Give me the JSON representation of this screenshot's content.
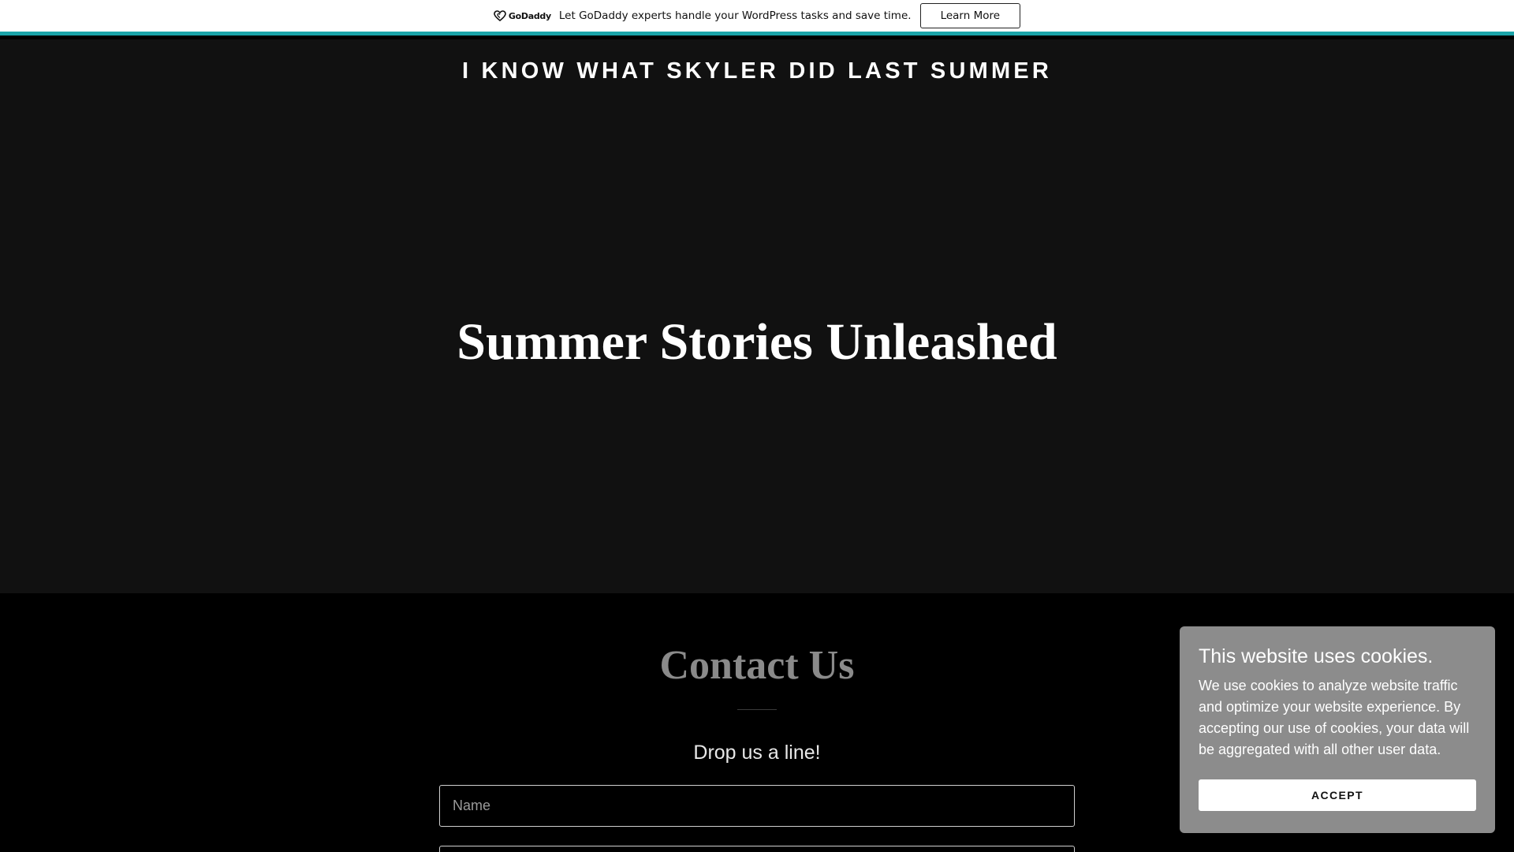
{
  "top_banner": {
    "logo_text": "GoDaddy",
    "message": "Let GoDaddy experts handle your WordPress tasks and save time.",
    "button_label": "Learn More",
    "accent_color": "#1aa3a8"
  },
  "header": {
    "site_title": "I KNOW WHAT SKYLER DID LAST SUMMER"
  },
  "hero": {
    "heading": "Summer Stories Unleashed",
    "background_color": "#111111"
  },
  "contact": {
    "title": "Contact Us",
    "subtitle": "Drop us a line!",
    "name_placeholder": "Name",
    "next_placeholder": ""
  },
  "cookie_banner": {
    "title": "This website uses cookies.",
    "body": "We use cookies to analyze website traffic and optimize your website experience. By accepting our use of cookies, your data will be aggregated with all other user data.",
    "accept_label": "ACCEPT",
    "background_color": "#8c8c8c"
  }
}
